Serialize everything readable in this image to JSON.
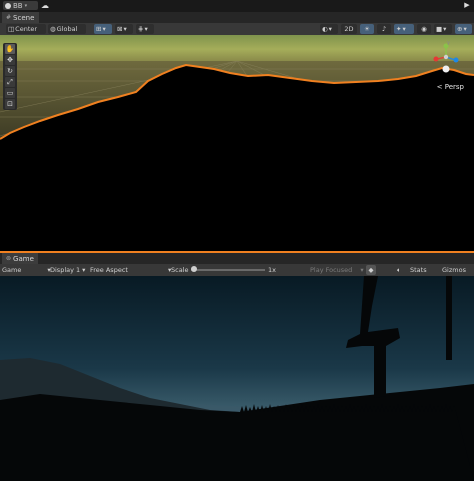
{
  "toolbar": {
    "account_label": "BB",
    "account_icon": "account-icon",
    "cloud_icon": "cloud-icon",
    "play_icon": "play-icon"
  },
  "scene_tab": {
    "label": "Scene",
    "icon": "scene-grid-icon"
  },
  "scene_toolbar": {
    "pivot_label": "Center",
    "space_label": "Global",
    "mode_2d_label": "2D",
    "icons": [
      "pivot-icon",
      "global-icon",
      "move-tool-icon",
      "snap-icon",
      "grid-icon",
      "shading-icon",
      "light-icon",
      "audio-icon",
      "effects-icon",
      "visibility-icon",
      "camera-icon",
      "gizmos-icon"
    ]
  },
  "scene_tools": [
    "hand-tool-icon",
    "move-tool-icon",
    "rotate-tool-icon",
    "scale-tool-icon",
    "rect-tool-icon",
    "transform-tool-icon"
  ],
  "scene_view": {
    "projection_label": "Persp",
    "gizmo_axis_y": "y",
    "highlight_color": "#f08020"
  },
  "game_tab": {
    "label": "Game",
    "icon": "gamepad-icon"
  },
  "game_toolbar": {
    "view_label": "Game",
    "display_label": "Display 1",
    "aspect_label": "Free Aspect",
    "scale_label": "Scale",
    "scale_value": "1x",
    "play_focused_label": "Play Focused",
    "stats_label": "Stats",
    "gizmos_label": "Gizmos",
    "icons": [
      "mute-icon",
      "unity-icon"
    ]
  }
}
